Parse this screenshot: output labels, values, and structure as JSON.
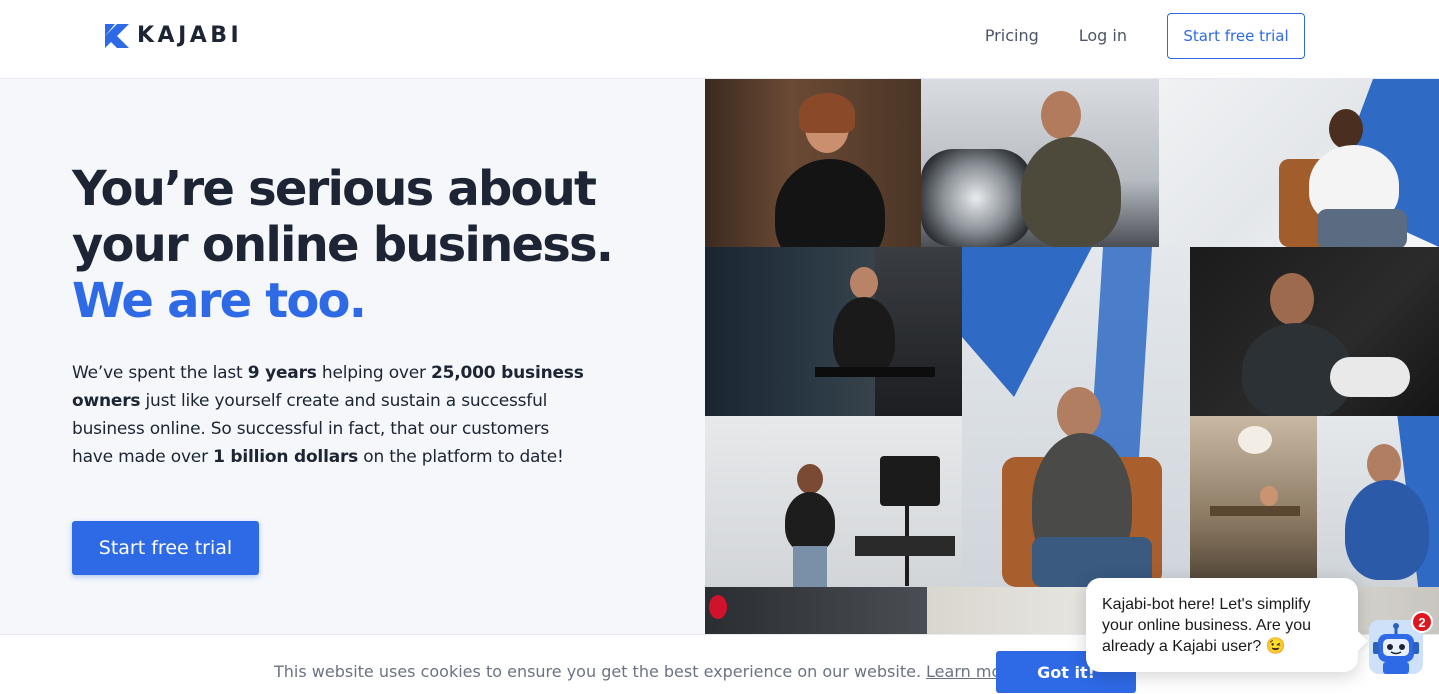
{
  "header": {
    "logo_text": "KAJABI",
    "nav": {
      "pricing": "Pricing",
      "login": "Log in",
      "cta": "Start free trial"
    }
  },
  "hero": {
    "headline_line1": "You’re serious about",
    "headline_line2": "your online business.",
    "headline_accent": "We are too.",
    "desc": {
      "p1": "We’ve spent the last ",
      "b1": "9 years",
      "p2": " helping over ",
      "b2": "25,000 business owners",
      "p3": " just like yourself create and sustain a successful business online. So successful in fact, that our customers have made over ",
      "b3": "1 billion dollars",
      "p4": " on the platform to date!"
    },
    "cta": "Start free trial"
  },
  "cookie": {
    "text": "This website uses cookies to ensure you get the best experience on our website.",
    "link": "Learn more",
    "button": "Got it!"
  },
  "chat": {
    "message": "Kajabi-bot here! Let's simplify your online business. Are you already a Kajabi user? 😉",
    "badge_count": "2"
  },
  "colors": {
    "brand_blue": "#2e6ae6",
    "text_dark": "#1d2433",
    "hero_bg": "#f5f7fa",
    "badge_red": "#e0161f"
  },
  "icons": [
    "kajabi-logo-icon",
    "chat-bot-icon"
  ]
}
